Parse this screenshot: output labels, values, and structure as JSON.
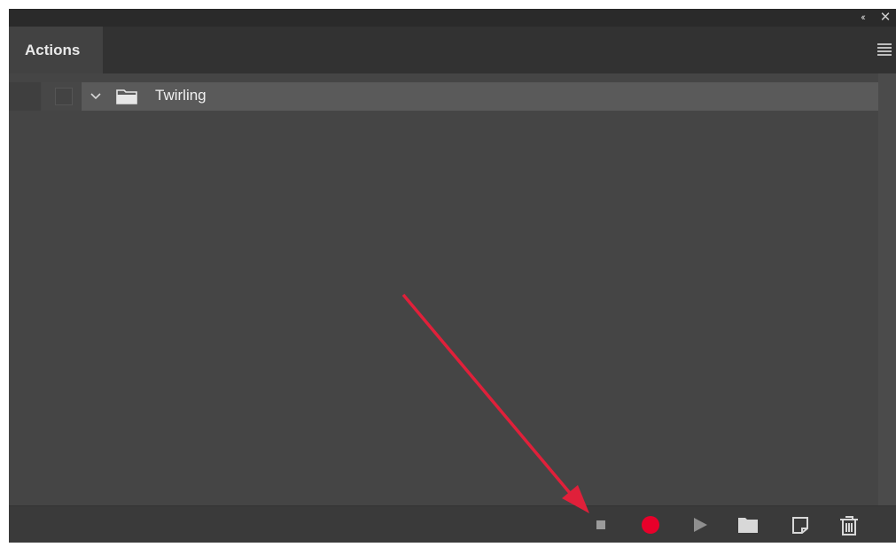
{
  "panel": {
    "tab_label": "Actions"
  },
  "topbar": {
    "collapse_glyph": "‹‹",
    "close_glyph": "✕"
  },
  "actions": [
    {
      "label": "Twirling",
      "type": "set",
      "expanded": true,
      "checked": false
    }
  ],
  "toolbar": {
    "icons": [
      "stop-icon",
      "record-icon",
      "play-icon",
      "new-set-icon",
      "new-action-icon",
      "delete-icon"
    ],
    "colors": {
      "record": "#e8002a",
      "annotation_arrow": "#e0203a",
      "icon": "#a8a8a8",
      "icon_bright": "#d8d8d8"
    }
  }
}
